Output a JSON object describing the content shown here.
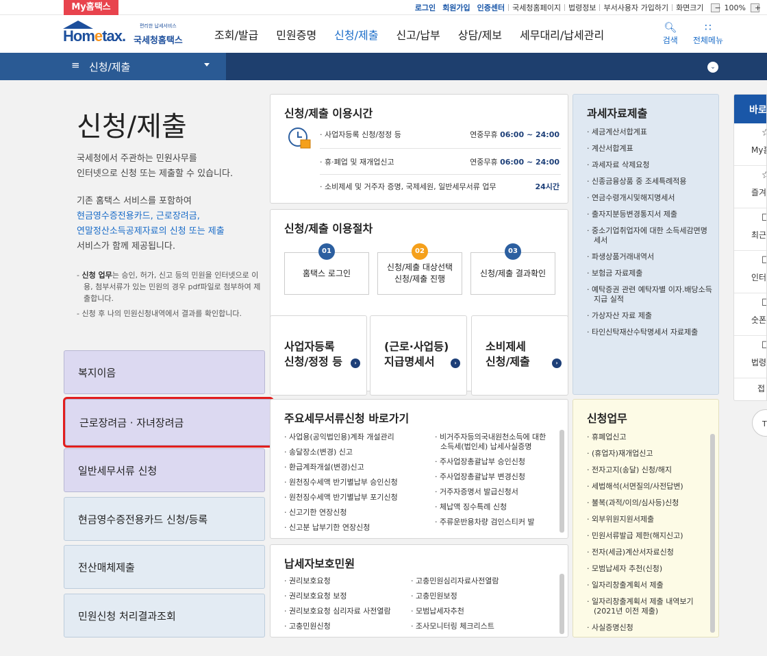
{
  "topbar": {
    "myhome": "My홈택스",
    "links": [
      "로그인",
      "회원가입",
      "인증센터",
      "국세청홈페이지",
      "법령정보",
      "부서사용자 가입하기",
      "화면크기"
    ],
    "zoom": "100%",
    "zoom_minus": "−",
    "zoom_plus": "+"
  },
  "header": {
    "logo_small": "편리한 납세서비스",
    "logo_home": "Hom",
    "logo_e": "e",
    "logo_tax": "tax.",
    "logo_kr": "국세청홈택스",
    "nav": [
      "조회/발급",
      "민원증명",
      "신청/제출",
      "신고/납부",
      "상담/제보",
      "세무대리/납세관리"
    ],
    "search": "검색",
    "allmenu": "전체메뉴"
  },
  "navbar": {
    "menu_icon": "≡",
    "title": "신청/제출",
    "toggle": "⌄"
  },
  "page": {
    "title": "신청/제출",
    "desc1": "국세청에서 주관하는 민원사무를",
    "desc2": "인터넷으로 신청 또는 제출할 수 있습니다.",
    "desc3": "기존 홈택스 서비스를 포함하여",
    "desc4": "현금영수증전용카드, 근로장려금,",
    "desc5": "연말정산소득공제자료의 신청 또는 제출",
    "desc6": "서비스가 함께 제공됩니다.",
    "note1_bold": "신청 업무",
    "note1": "는 승인, 허가, 신고 등의 민원을 인터넷으로 이용, 첨부서류가 있는 민원의 경우 pdf파일로 첨부하여 제출합니다.",
    "note2": "신청 후 나의 민원신청내역에서 결과를 확인합니다."
  },
  "left_buttons": [
    "복지이음",
    "근로장려금 · 자녀장려금",
    "일반세무서류 신청",
    "현금영수증전용카드 신청/등록",
    "전산매체제출",
    "민원신청 처리결과조회"
  ],
  "hours": {
    "title": "신청/제출 이용시간",
    "rows": [
      {
        "label": "· 사업자등록 신청/정정 등",
        "day": "연중무휴",
        "time": "06:00 ~ 24:00"
      },
      {
        "label": "· 휴·폐업 및 재개업신고",
        "day": "연중무휴",
        "time": "06:00 ~ 24:00"
      },
      {
        "label": "· 소비제세 및 거주자 증명, 국제세원, 일반세무서류 업무",
        "day": "",
        "time": "24시간"
      }
    ]
  },
  "procedure": {
    "title": "신청/제출 이용절차",
    "steps": [
      {
        "num": "01",
        "l1": "홈택스 로그인",
        "l2": ""
      },
      {
        "num": "02",
        "l1": "신청/제출 대상선택",
        "l2": "신청/제출 진행"
      },
      {
        "num": "03",
        "l1": "신청/제출 결과확인",
        "l2": ""
      }
    ]
  },
  "cards": [
    {
      "l1": "사업자등록",
      "l2": "신청/정정 등"
    },
    {
      "l1": "(근로·사업등)",
      "l2": "지급명세서"
    },
    {
      "l1": "소비제세",
      "l2": "신청/제출"
    }
  ],
  "card_go": "›",
  "tax_data": {
    "title": "과세자료제출",
    "items": [
      "세금계산서합계표",
      "계산서합계표",
      "과세자료 삭제요청",
      "신종금융상품 중 조세특례적용",
      "연금수령개시및해지명세서",
      "출자지분등변경통지서 제출",
      "중소기업취업자에 대한 소득세감면명세서",
      "파생상품거래내역서",
      "보험금 자료제출",
      "예탁증권 관련 예탁자별 이자.배당소득 지급 실적",
      "가상자산 자료 제출",
      "타인신탁재산수탁명세서 자료제출"
    ]
  },
  "main_docs": {
    "title": "주요세무서류신청 바로가기",
    "col1": [
      "사업용(공익법인용)계좌 개설관리",
      "송달장소(변경) 신고",
      "환급계좌개설(변경)신고",
      "원천징수세액 반기별납부 승인신청",
      "원천징수세액 반기별납부 포기신청",
      "신고기한 연장신청",
      "신고분 납부기한 연장신청"
    ],
    "col2": [
      "비거주자등의국내원천소득에 대한 소득세(법인세) 납세사실증명",
      "주사업장총괄납부 승인신청",
      "주사업장총괄납부 변경신청",
      "거주자증명서 발급신청서",
      "체납액 징수특례 신청",
      "주류운반용차량 검인스티커 발"
    ]
  },
  "protection": {
    "title": "납세자보호민원",
    "col1": [
      "권리보호요청",
      "권리보호요청 보정",
      "권리보호요청 심리자료 사전열람",
      "고충민원신청"
    ],
    "col2": [
      "고충민원심리자료사전열람",
      "고충민원보정",
      "모범납세자추천",
      "조사모니터링 체크리스트"
    ]
  },
  "apply_work": {
    "title": "신청업무",
    "items": [
      "휴폐업신고",
      "(휴업자)재개업신고",
      "전자고지(송달) 신청/해지",
      "세법해석(서면질의/사전답변)",
      "불복(과적/이의/심사등)신청",
      "외부위원지원서제출",
      "민원서류발급 제한(해지신고)",
      "전자(세금)계산서자료신청",
      "모범납세자 추천(신청)",
      "일자리창출계획서 제출",
      "일자리창출계획서 제출 내역보기(2021년 이전 제출)",
      "사실증명신청"
    ]
  },
  "sidebar": {
    "head": "바로",
    "items": [
      {
        "icon": "☆",
        "label": "My홈"
      },
      {
        "icon": "☆",
        "label": "즐겨"
      },
      {
        "icon": "☐",
        "label": "최근접"
      },
      {
        "icon": "☐",
        "label": "인터넷"
      },
      {
        "icon": "☐",
        "label": "숫폰"
      },
      {
        "icon": "☐",
        "label": "법령"
      }
    ],
    "last": "접",
    "top": "T"
  },
  "colors": {
    "brand": "#1d4f9c",
    "accent": "#1a6cc8",
    "highlight": "#e21d1d"
  }
}
